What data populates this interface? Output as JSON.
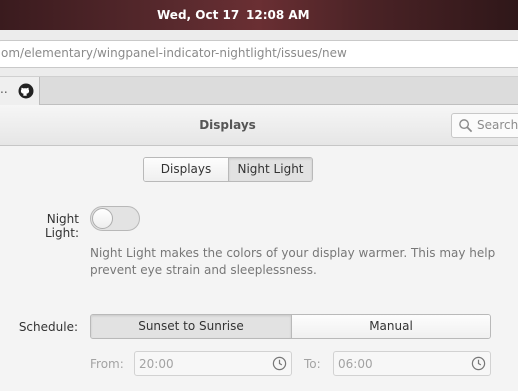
{
  "panel": {
    "date": "Wed, Oct 17",
    "time": "12:08 AM"
  },
  "browser": {
    "url": "om/elementary/wingpanel-indicator-nightlight/issues/new",
    "tab_ellipsis": "..",
    "tab_icon": "github-icon"
  },
  "window": {
    "title": "Displays",
    "search_placeholder": "Search"
  },
  "stack_switcher": {
    "items": [
      "Displays",
      "Night Light"
    ],
    "selected": "Night Light"
  },
  "night_light": {
    "label": "Night Light:",
    "enabled": false,
    "description": "Night Light makes the colors of your display warmer. This may help prevent eye strain and sleeplessness."
  },
  "schedule": {
    "label": "Schedule:",
    "options": [
      "Sunset to Sunrise",
      "Manual"
    ],
    "selected": "Sunset to Sunrise",
    "from_label": "From:",
    "from_value": "20:00",
    "to_label": "To:",
    "to_value": "06:00"
  },
  "colors": {
    "panel_bg": "#5a2a2e",
    "window_bg": "#f4f4f4",
    "dim_text": "#a3a3a3"
  }
}
